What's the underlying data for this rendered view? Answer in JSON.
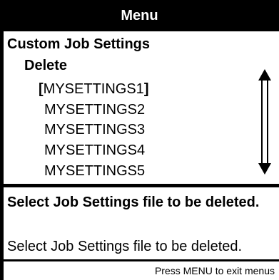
{
  "header": {
    "title": "Menu"
  },
  "menu": {
    "section": "Custom Job Settings",
    "submenu": "Delete",
    "items": [
      {
        "open_bracket": "[",
        "label": "MYSETTINGS1",
        "close_bracket": "]"
      },
      {
        "label": "MYSETTINGS2"
      },
      {
        "label": "MYSETTINGS3"
      },
      {
        "label": "MYSETTINGS4"
      },
      {
        "label": "MYSETTINGS5"
      }
    ]
  },
  "help": {
    "title": "Select Job Settings file to be deleted.",
    "text": "Select Job Settings file to be deleted."
  },
  "footer": {
    "text": "Press MENU to exit menus"
  },
  "icons": {
    "scroll": "scroll-up-down-icon"
  },
  "colors": {
    "background": "#ffffff",
    "foreground": "#000000",
    "header_text": "#ffffff"
  }
}
